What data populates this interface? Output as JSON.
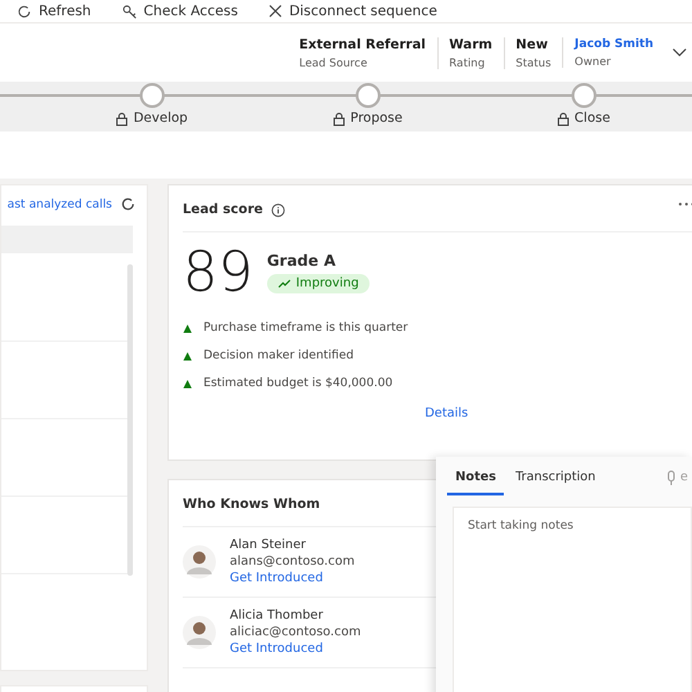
{
  "command_bar": [
    {
      "label": "Refresh"
    },
    {
      "label": "Check Access"
    },
    {
      "label": "Disconnect sequence"
    }
  ],
  "header": {
    "fields": [
      {
        "value": "External Referral",
        "label": "Lead Source",
        "kind": "text"
      },
      {
        "value": "Warm",
        "label": "Rating",
        "kind": "text"
      },
      {
        "value": "New",
        "label": "Status",
        "kind": "text"
      },
      {
        "value": "Jacob Smith",
        "label": "Owner",
        "kind": "link"
      }
    ]
  },
  "process_stages": [
    {
      "label": "Develop"
    },
    {
      "label": "Propose"
    },
    {
      "label": "Close"
    }
  ],
  "calls_panel": {
    "link": "ast analyzed calls"
  },
  "lead_score": {
    "title": "Lead score",
    "score": "89",
    "grade": "Grade A",
    "trend": "Improving",
    "factors": [
      {
        "text": "Purchase timeframe is this quarter"
      },
      {
        "text": "Decision maker identified"
      },
      {
        "text": "Estimated budget is $40,000.00"
      }
    ],
    "details_link": "Details"
  },
  "who_knows_whom": {
    "title": "Who Knows Whom",
    "contacts": [
      {
        "name": "Alan Steiner",
        "email": "alans@contoso.com",
        "action": "Get Introduced"
      },
      {
        "name": "Alicia Thomber",
        "email": "aliciac@contoso.com",
        "action": "Get Introduced"
      }
    ]
  },
  "notes_panel": {
    "tabs": [
      {
        "label": "Notes",
        "selected": true
      },
      {
        "label": "Transcription",
        "selected": false
      }
    ],
    "trailing_text": "e",
    "placeholder": "Start taking notes"
  }
}
